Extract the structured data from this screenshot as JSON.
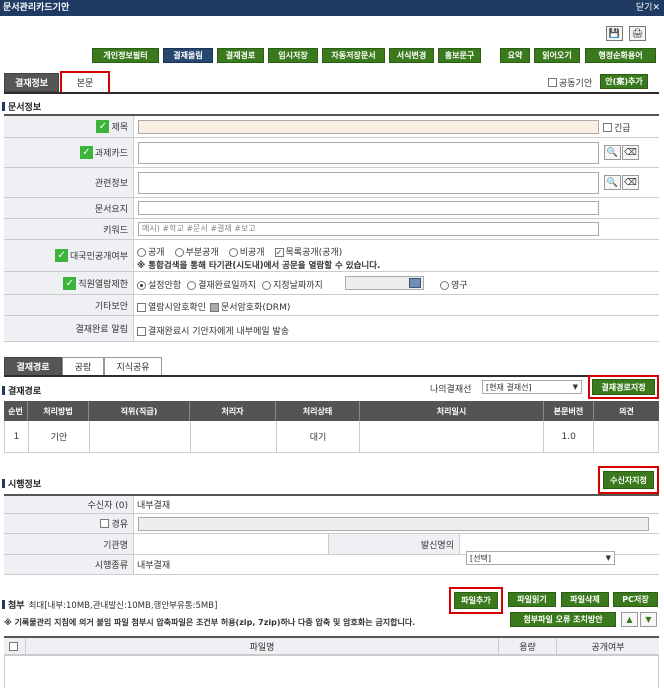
{
  "window": {
    "title": "문서관리카드기안",
    "close_label": "닫기"
  },
  "toolbar_buttons": [
    "개인정보필터",
    "결재올림",
    "결재경로",
    "임시저장",
    "자동저장문서",
    "서식변경",
    "홍보문구",
    "요약",
    "읽어오기",
    "행정순화용어"
  ],
  "doc_tabs": [
    "결재정보",
    "본문"
  ],
  "collab": {
    "label": "공동기안",
    "button": "안(案)추가"
  },
  "doc_info": {
    "section": "문서정보",
    "title_label": "제목",
    "urgent": "긴급",
    "task_card_label": "과제카드",
    "related_label": "관련정보",
    "summary_label": "문서요지",
    "keyword_label": "키워드",
    "keyword_placeholder": "예시) #학교 #문서 #결재 #보고",
    "disclosure_label": "대국민공개여부",
    "disclosure_options": [
      "공개",
      "부분공개",
      "비공개"
    ],
    "disclosure_list_label": "목록공개(공개)",
    "disclosure_note": "※ 통합검색을 통해 타기관(시도내)에서 공문을 열람할 수 있습니다.",
    "restrict_label": "직원열람제한",
    "restrict_options": [
      "설정안함",
      "결재완료일까지",
      "지정날짜까지"
    ],
    "restrict_forever": "영구",
    "security_label": "기타보안",
    "security_opt1": "열람시암호확인",
    "security_opt2": "문서암호화(DRM)",
    "notify_label": "결재완료 알림",
    "notify_text": "결재완료시 기안자에게 내부메일 발송"
  },
  "approval_tabs": [
    "결재경로",
    "공람",
    "지식공유"
  ],
  "approval": {
    "section": "결재경로",
    "my_line_label": "나의결재선",
    "my_line_value": "[현재 결재선]",
    "set_button": "결재경로지정",
    "columns": [
      "순번",
      "처리방법",
      "직위(직급)",
      "처리자",
      "처리상태",
      "처리일시",
      "본문버전",
      "의견"
    ],
    "rows": [
      {
        "no": "1",
        "method": "기안",
        "position": "",
        "person": "",
        "status": "대기",
        "date": "",
        "version": "1.0",
        "opinion": ""
      }
    ]
  },
  "dispatch": {
    "section": "시행정보",
    "recipient_button": "수신자지정",
    "recipient_label": "수신자 (0)",
    "recipient_value": "내부결재",
    "via_label": "경유",
    "org_label": "기관명",
    "org_value": "",
    "sender_label": "발신명의",
    "sender_value": "[선택]",
    "type_label": "시행종류",
    "type_value": "내부결재"
  },
  "attach": {
    "section": "첨부",
    "limit": "최대[내부:10MB,관내발신:10MB,행안부유통:5MB]",
    "note": "※ 기록물관리 지침에 의거 붙임 파일 첨부시 압축파일은 조건부 허용(zip, 7zip)하나 다중 압축 및 암호화는 금지합니다.",
    "buttons": [
      "파일추가",
      "파일읽기",
      "파일삭제",
      "PC저장"
    ],
    "error_button": "첨부파일 오류 조치방안",
    "columns": [
      "파일명",
      "용량",
      "공개여부"
    ]
  }
}
